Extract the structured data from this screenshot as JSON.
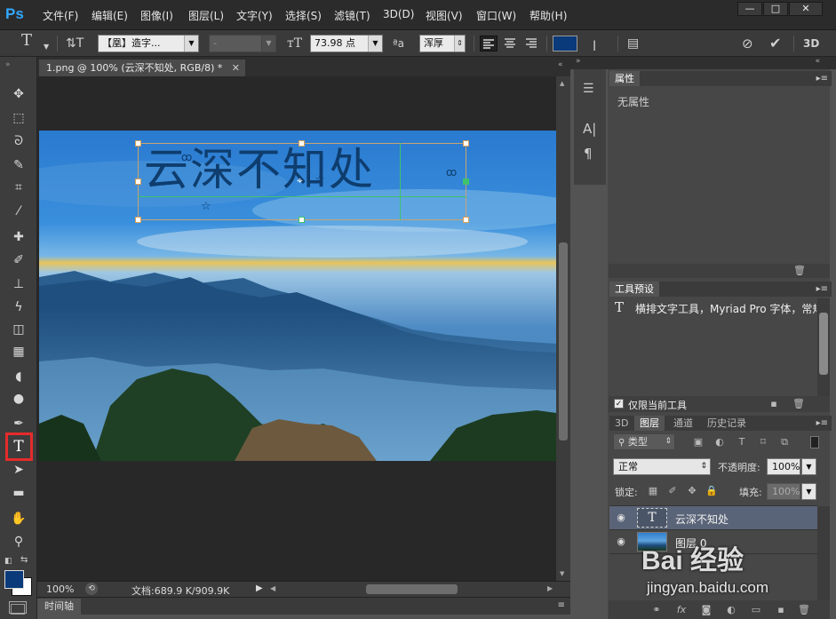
{
  "app": {
    "logo": "Ps"
  },
  "menu": [
    "文件(F)",
    "编辑(E)",
    "图像(I)",
    "图层(L)",
    "文字(Y)",
    "选择(S)",
    "滤镜(T)",
    "3D(D)",
    "视图(V)",
    "窗口(W)",
    "帮助(H)"
  ],
  "window_controls": [
    "—",
    "□",
    "✕"
  ],
  "options": {
    "font_family": "【凰】造字...",
    "font_style": "-",
    "font_size": "73.98 点",
    "aa_label": "ªa",
    "antialias": "浑厚",
    "text_color": "#0a3a7a"
  },
  "document": {
    "tab_title": "1.png @ 100% (云深不知处, RGB/8) *",
    "text_layer_content": "云深不知处",
    "zoom": "100%",
    "doc_info": "文档:689.9 K/909.9K",
    "timeline_label": "时间轴"
  },
  "panels": {
    "properties": {
      "title": "属性",
      "empty_label": "无属性"
    },
    "tool_presets": {
      "title": "工具预设",
      "item": "横排文字工具，Myriad Pro 字体，常规",
      "current_tool_only": "仅限当前工具"
    },
    "layers": {
      "tabs": [
        "3D",
        "图层",
        "通道",
        "历史记录"
      ],
      "active_tab": "图层",
      "filter_kind": "类型",
      "blend_mode": "正常",
      "opacity_label": "不透明度:",
      "opacity": "100%",
      "lock_label": "锁定:",
      "fill_label": "填充:",
      "fill": "100%",
      "items": [
        {
          "name": "云深不知处",
          "type": "text"
        },
        {
          "name": "图层 0",
          "type": "image"
        }
      ]
    }
  },
  "watermark": {
    "text": "Bai 经验",
    "url": "jingyan.baidu.com"
  }
}
